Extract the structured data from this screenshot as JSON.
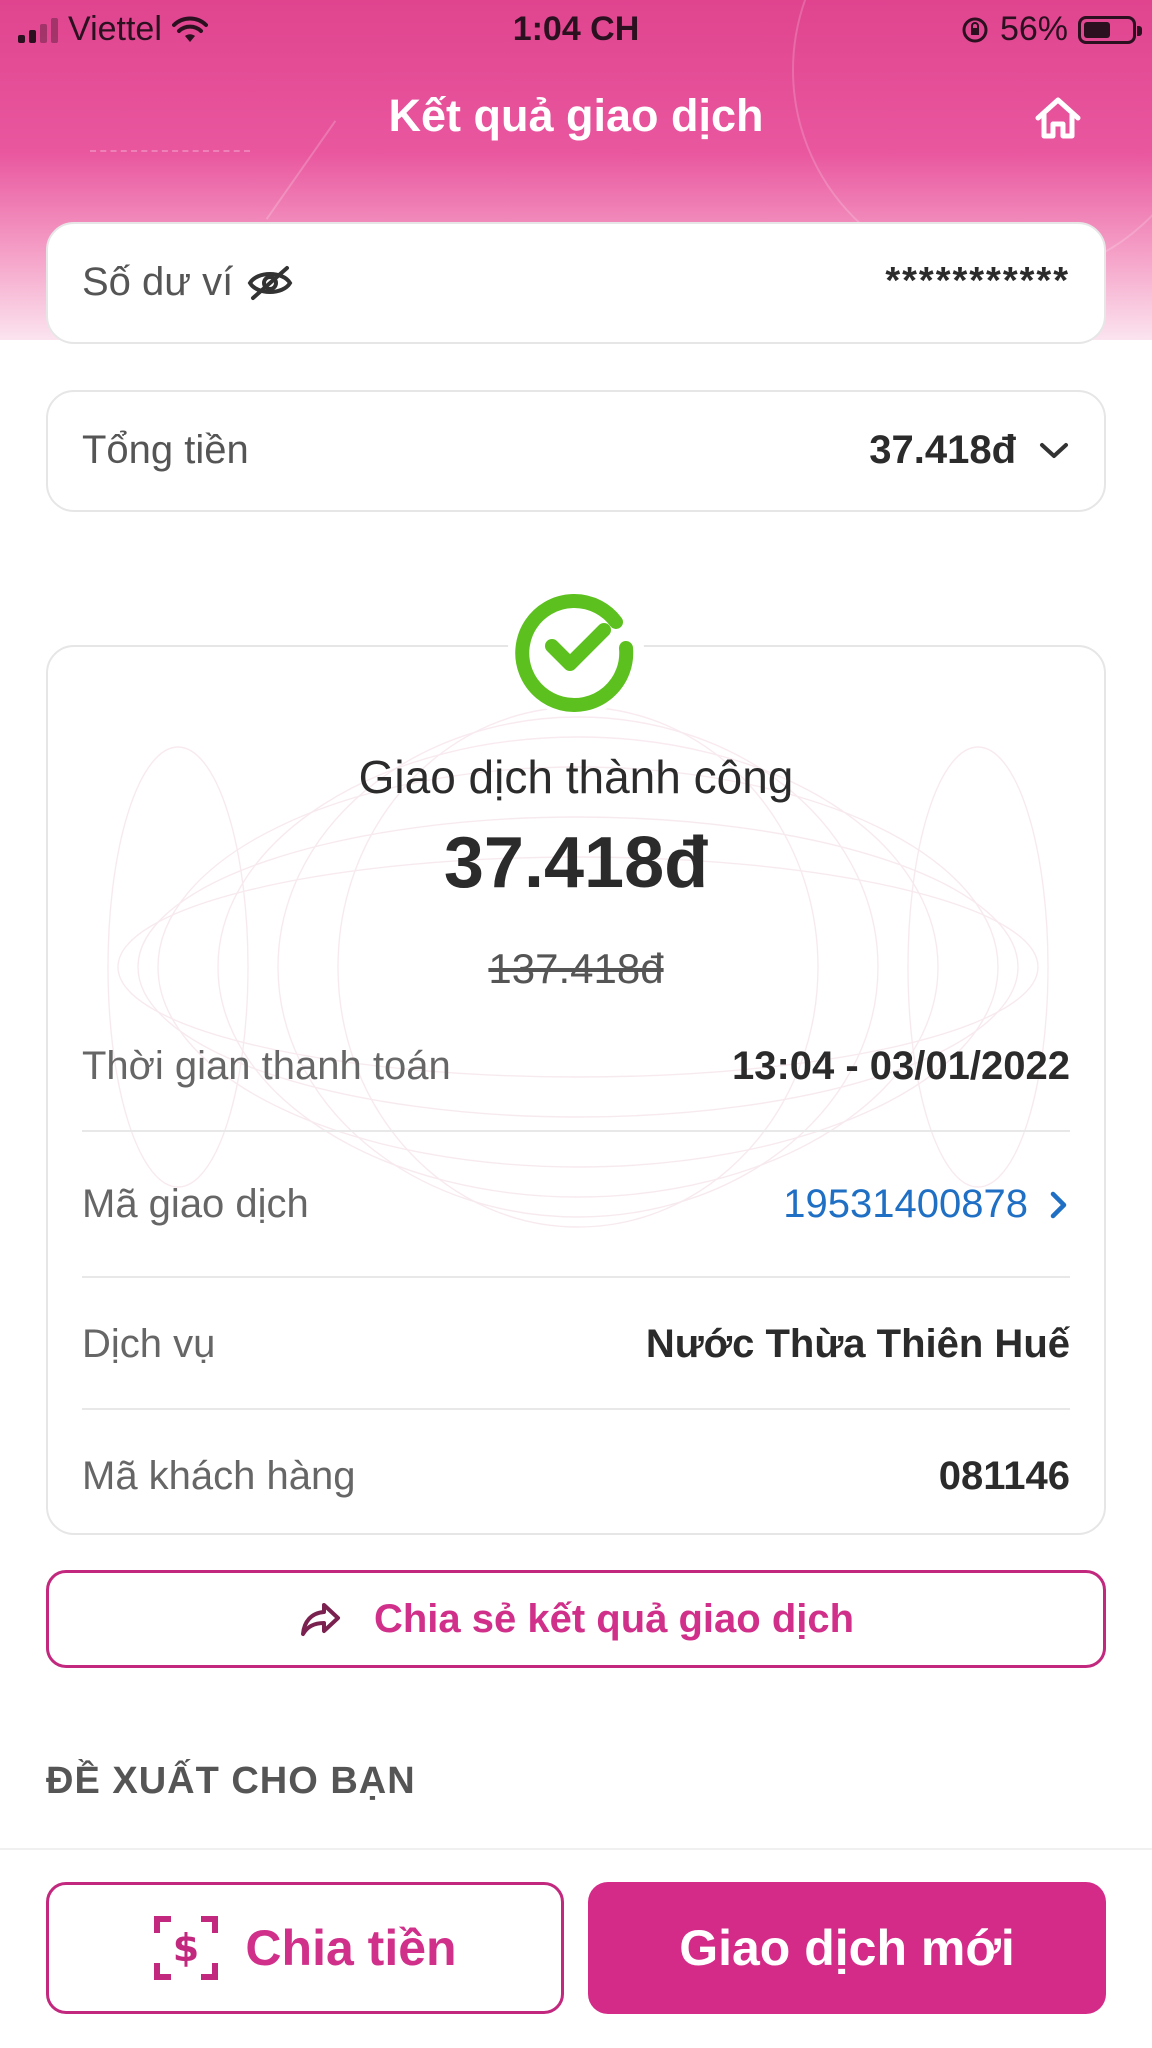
{
  "status_bar": {
    "carrier": "Viettel",
    "time": "1:04 CH",
    "battery": "56%",
    "battery_level": 0.56
  },
  "header": {
    "title": "Kết quả giao dịch",
    "home_icon": "home-icon"
  },
  "balance": {
    "label": "Số dư ví",
    "value": "***********",
    "icon": "eye-off-icon"
  },
  "total": {
    "label": "Tổng tiền",
    "value": "37.418đ",
    "icon": "chevron-down-icon"
  },
  "receipt": {
    "status_icon": "check-circle-icon",
    "status_text": "Giao dịch thành công",
    "amount": "37.418đ",
    "original_amount": "137.418đ",
    "rows": [
      {
        "label": "Thời gian thanh toán",
        "value": "13:04 - 03/01/2022"
      },
      {
        "label": "Mã giao dịch",
        "value": "19531400878"
      },
      {
        "label": "Dịch vụ",
        "value": "Nước Thừa Thiên Huế"
      },
      {
        "label": "Mã khách hàng",
        "value": "081146"
      }
    ]
  },
  "share_button": "Chia sẻ kết quả giao dịch",
  "suggest_heading": "ĐỀ XUẤT CHO BẠN",
  "bottom": {
    "split_label": "Chia tiền",
    "new_label": "Giao dịch mới"
  },
  "colors": {
    "brand": "#d42b88",
    "success": "#5cc11e",
    "link": "#1f6fc5"
  }
}
